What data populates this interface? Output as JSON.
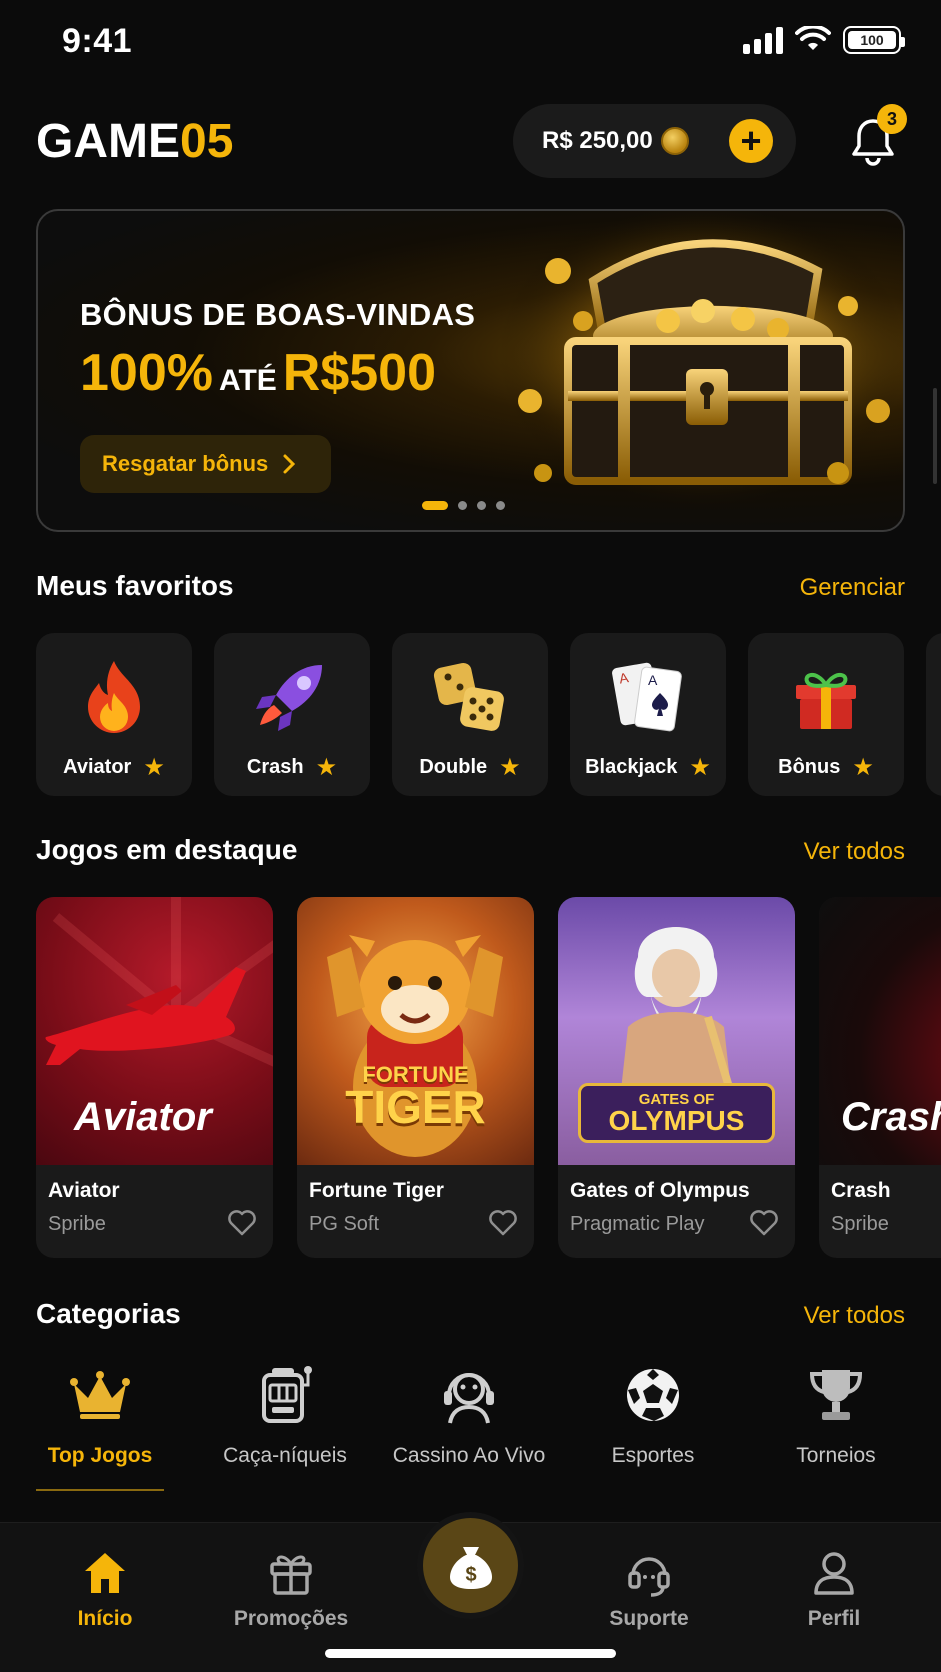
{
  "status_bar": {
    "time": "9:41",
    "battery": "100"
  },
  "header": {
    "logo_main": "GAME",
    "logo_accent": "05",
    "balance": "R$ 250,00",
    "add_label": "+",
    "notification_count": "3"
  },
  "banner": {
    "line1": "BÔNUS DE BOAS-VINDAS",
    "percent": "100%",
    "ate": "ATÉ",
    "amount": "R$500",
    "cta_label": "Resgatar bônus",
    "slides": 4,
    "active_slide": 0
  },
  "favorites": {
    "title": "Meus favoritos",
    "link": "Gerenciar",
    "items": [
      {
        "label": "Aviator",
        "icon": "flame-icon"
      },
      {
        "label": "Crash",
        "icon": "rocket-icon"
      },
      {
        "label": "Double",
        "icon": "dice-icon"
      },
      {
        "label": "Blackjack",
        "icon": "cards-icon"
      },
      {
        "label": "Bônus",
        "icon": "gift-icon"
      }
    ]
  },
  "featured": {
    "title": "Jogos em destaque",
    "link": "Ver todos",
    "games": [
      {
        "name": "Aviator",
        "provider": "Spribe",
        "art_title": "Aviator"
      },
      {
        "name": "Fortune Tiger",
        "provider": "PG Soft",
        "art_title_1": "FORTUNE",
        "art_title_2": "TIGER"
      },
      {
        "name": "Gates of Olympus",
        "provider": "Pragmatic Play",
        "art_title_1": "GATES OF",
        "art_title_2": "OLYMPUS"
      },
      {
        "name": "Crash",
        "provider": "Spribe",
        "art_title": "Crash"
      }
    ]
  },
  "categories": {
    "title": "Categorias",
    "link": "Ver todos",
    "items": [
      {
        "label": "Top Jogos",
        "icon": "crown-icon",
        "active": true
      },
      {
        "label": "Caça-níqueis",
        "icon": "slot-machine-icon"
      },
      {
        "label": "Cassino Ao Vivo",
        "icon": "live-dealer-icon"
      },
      {
        "label": "Esportes",
        "icon": "soccer-ball-icon"
      },
      {
        "label": "Torneios",
        "icon": "trophy-icon"
      }
    ]
  },
  "bottom_nav": {
    "items": [
      {
        "label": "Início",
        "icon": "home-icon",
        "active": true
      },
      {
        "label": "Promoções",
        "icon": "gift-icon"
      },
      {
        "label": "Suporte",
        "icon": "headset-icon"
      },
      {
        "label": "Perfil",
        "icon": "user-icon"
      }
    ],
    "center_icon": "money-bag-icon",
    "center_symbol": "$"
  },
  "colors": {
    "accent": "#f5b50a",
    "background": "#0b0b0b",
    "card": "#1a1a1a"
  }
}
